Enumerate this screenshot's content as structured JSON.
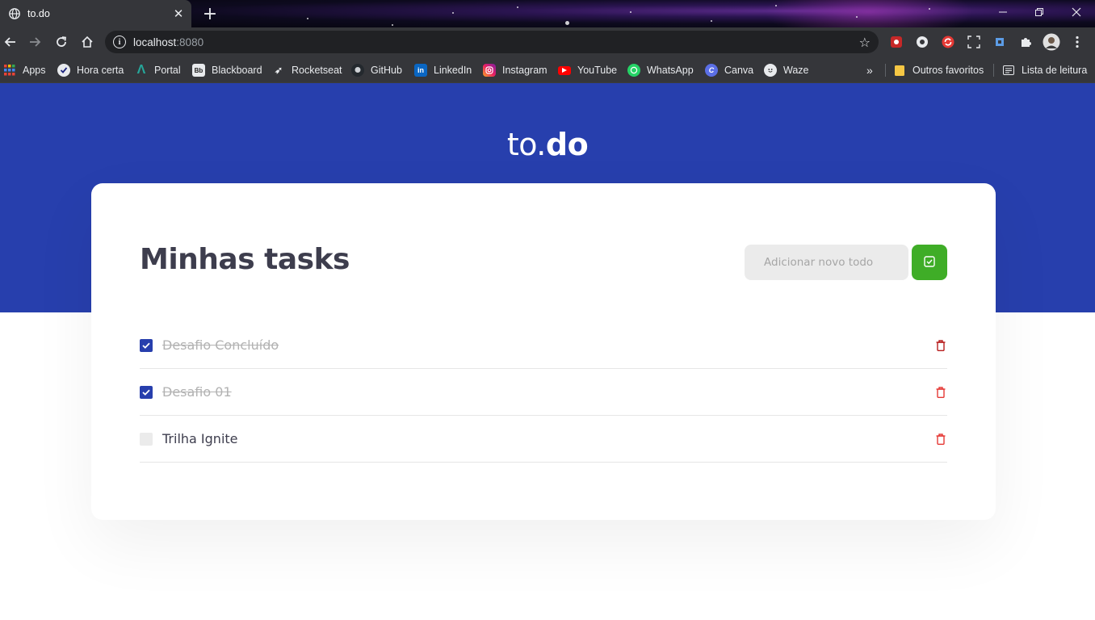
{
  "browser": {
    "tab_title": "to.do",
    "url_host": "localhost",
    "url_port": ":8080",
    "bookmarks": [
      {
        "label": "Apps",
        "icon": "apps-grid-icon"
      },
      {
        "label": "Hora certa",
        "icon": "clock-check-icon"
      },
      {
        "label": "Portal",
        "icon": "portal-icon"
      },
      {
        "label": "Blackboard",
        "icon": "blackboard-icon"
      },
      {
        "label": "Rocketseat",
        "icon": "rocketseat-icon"
      },
      {
        "label": "GitHub",
        "icon": "github-icon"
      },
      {
        "label": "LinkedIn",
        "icon": "linkedin-icon"
      },
      {
        "label": "Instagram",
        "icon": "instagram-icon"
      },
      {
        "label": "YouTube",
        "icon": "youtube-icon"
      },
      {
        "label": "WhatsApp",
        "icon": "whatsapp-icon"
      },
      {
        "label": "Canva",
        "icon": "canva-icon"
      },
      {
        "label": "Waze",
        "icon": "waze-icon"
      }
    ],
    "other_bookmarks": "Outros favoritos",
    "reading_list": "Lista de leitura"
  },
  "app": {
    "logo_light": "to.",
    "logo_bold": "do",
    "title": "Minhas tasks",
    "new_todo_placeholder": "Adicionar novo todo",
    "accent_color": "#273fad",
    "add_button_color": "#3fad27",
    "tasks": [
      {
        "title": "Desafio Concluído",
        "completed": true
      },
      {
        "title": "Desafio 01",
        "completed": true
      },
      {
        "title": "Trilha Ignite",
        "completed": false
      }
    ]
  }
}
